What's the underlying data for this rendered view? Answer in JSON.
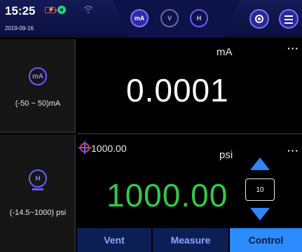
{
  "status_bar": {
    "time": "15:25",
    "date": "2019-09-16",
    "battery_icon": "battery-icon",
    "wifi_icon": "wifi-icon"
  },
  "mode_bar": {
    "modes": [
      {
        "icon": "milliamp-mode-icon",
        "label": "mA",
        "active": true
      },
      {
        "icon": "voltage-mode-icon",
        "label": "V",
        "active": false
      },
      {
        "icon": "pressure-mode-icon",
        "label": "H",
        "active": false
      }
    ],
    "settings_icon": "settings-icon",
    "menu_icon": "menu-icon"
  },
  "channel_top": {
    "icon_label": "mA",
    "range": "(-50 ~ 50)mA",
    "unit": "mA",
    "more": "···",
    "reading": "0.0001"
  },
  "channel_bottom": {
    "icon_label": "H",
    "range": "(-14.5~1000) psi",
    "setpoint": "1000.00",
    "unit": "psi",
    "more": "···",
    "reading": "1000.00",
    "step": "10"
  },
  "actions": {
    "vent": "Vent",
    "measure": "Measure",
    "control": "Control"
  },
  "colors": {
    "accent_blue": "#2b8bff",
    "reading_green": "#37c64b",
    "topbar": "#141a55"
  }
}
